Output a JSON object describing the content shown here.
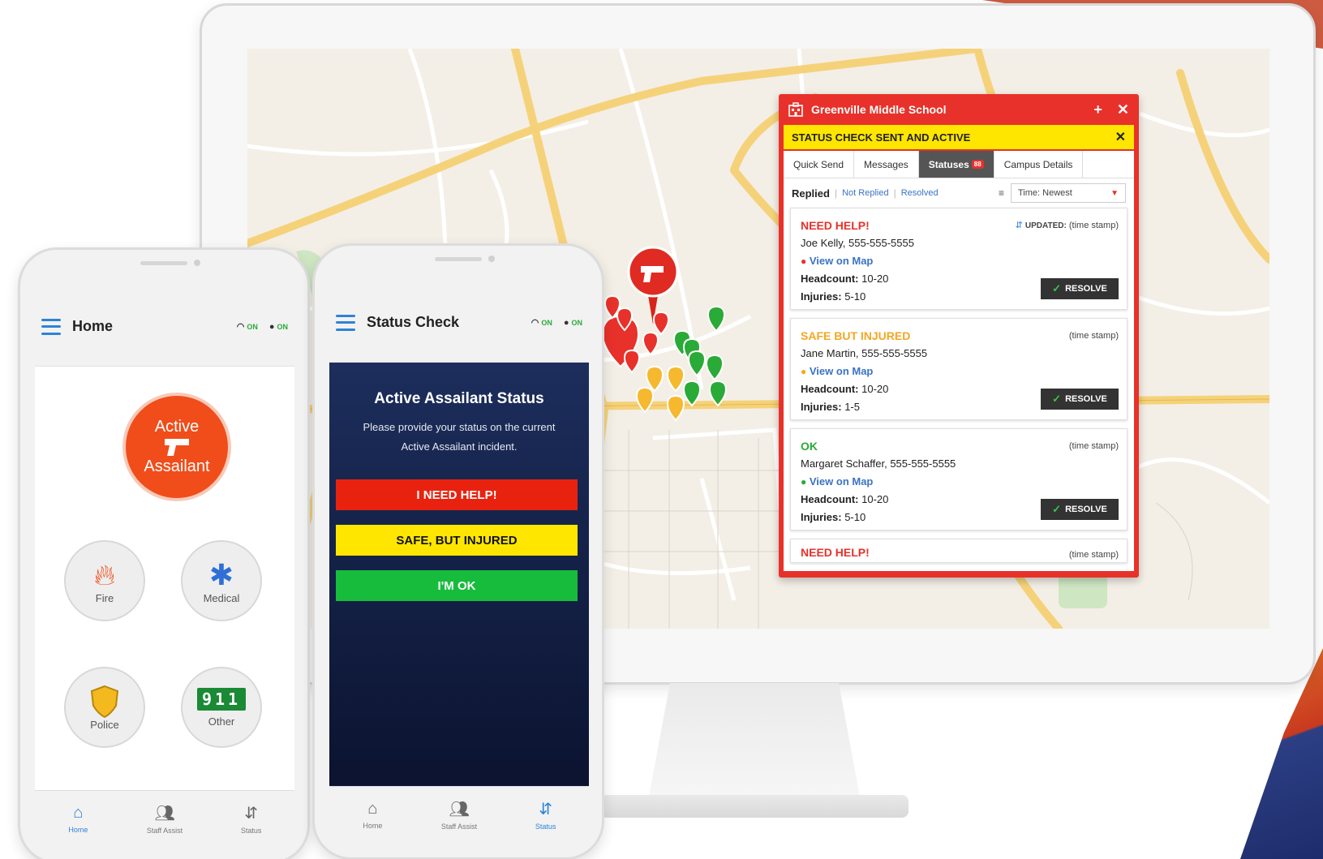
{
  "desktop": {
    "panel": {
      "title": "Greenville Middle School",
      "add_icon": "+",
      "close_icon": "✕",
      "alert": "STATUS CHECK SENT AND ACTIVE",
      "alert_close": "✕",
      "tabs": [
        {
          "label": "Quick Send"
        },
        {
          "label": "Messages"
        },
        {
          "label": "Statuses",
          "badge": "88"
        },
        {
          "label": "Campus Details"
        }
      ],
      "filters": {
        "replied": "Replied",
        "not_replied": "Not Replied",
        "resolved": "Resolved"
      },
      "sort": "Time: Newest",
      "resolve_label": "RESOLVE",
      "view_on_map": "View on Map",
      "headcount_label": "Headcount:",
      "injuries_label": "Injuries:",
      "cards": [
        {
          "status": "NEED HELP!",
          "status_color": "#e8312a",
          "updated_label": "UPDATED:",
          "time": "(time stamp)",
          "person": "Joe Kelly, 555-555-5555",
          "pin_color": "#e8312a",
          "headcount": "10-20",
          "injuries": "5-10"
        },
        {
          "status": "SAFE BUT INJURED",
          "status_color": "#f5a623",
          "time": "(time stamp)",
          "person": "Jane Martin, 555-555-5555",
          "pin_color": "#f5a623",
          "headcount": "10-20",
          "injuries": "1-5"
        },
        {
          "status": "OK",
          "status_color": "#2aaa37",
          "time": "(time stamp)",
          "person": "Margaret Schaffer, 555-555-5555",
          "pin_color": "#2aaa37",
          "headcount": "10-20",
          "injuries": "5-10"
        },
        {
          "status": "NEED HELP!",
          "status_color": "#e8312a",
          "time": "(time stamp)"
        }
      ]
    }
  },
  "phone_home": {
    "title": "Home",
    "wifi_status": "ON",
    "location_status": "ON",
    "main_button": {
      "line1": "Active",
      "line2": "Assailant"
    },
    "buttons": [
      {
        "label": "Fire",
        "icon": "fire-icon"
      },
      {
        "label": "Medical",
        "icon": "medical-star-icon"
      },
      {
        "label": "Police",
        "icon": "police-badge-icon"
      },
      {
        "label": "Other",
        "icon": "911-icon",
        "digits": "911"
      }
    ],
    "tabbar": [
      {
        "label": "Home",
        "active": true
      },
      {
        "label": "Staff Assist",
        "active": false
      },
      {
        "label": "Status",
        "active": false
      }
    ]
  },
  "phone_status": {
    "title": "Status Check",
    "wifi_status": "ON",
    "location_status": "ON",
    "heading": "Active Assailant Status",
    "description": "Please provide your status on the current Active Assailant incident.",
    "buttons": [
      {
        "label": "I NEED HELP!",
        "color": "#e8220f",
        "text_color": "#ffffff"
      },
      {
        "label": "SAFE, BUT INJURED",
        "color": "#ffe600",
        "text_color": "#111111"
      },
      {
        "label": "I'M OK",
        "color": "#17bc3c",
        "text_color": "#ffffff"
      }
    ],
    "tabbar": [
      {
        "label": "Home",
        "active": false
      },
      {
        "label": "Staff Assist",
        "active": false
      },
      {
        "label": "Status",
        "active": true
      }
    ]
  },
  "colors": {
    "red": "#e8312a",
    "yellow": "#ffe600",
    "green": "#2aaa37",
    "blue": "#2f82d6",
    "navy": "#1d2e5c"
  }
}
